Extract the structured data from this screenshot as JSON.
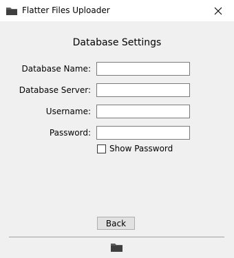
{
  "window": {
    "title": "Flatter Files Uploader",
    "app_icon": "folder-icon",
    "close_icon": "close-icon"
  },
  "form": {
    "heading": "Database Settings",
    "fields": [
      {
        "label": "Database Name:",
        "value": "",
        "placeholder": ""
      },
      {
        "label": "Database Server:",
        "value": "",
        "placeholder": ""
      },
      {
        "label": "Username:",
        "value": "",
        "placeholder": ""
      },
      {
        "label": "Password:",
        "value": "",
        "placeholder": ""
      }
    ],
    "show_password": {
      "label": "Show Password",
      "checked": false
    }
  },
  "footer": {
    "back_label": "Back",
    "icon": "folder-icon"
  }
}
